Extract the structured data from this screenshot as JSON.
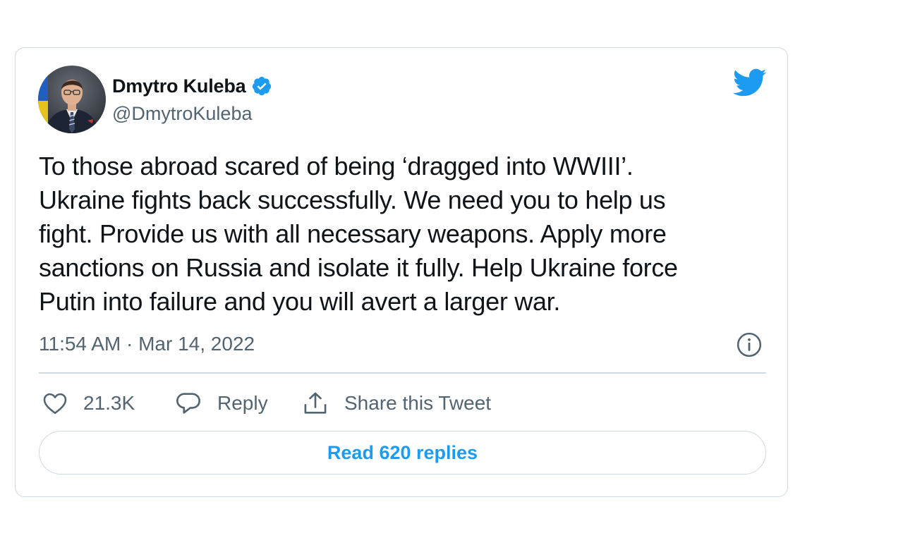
{
  "author": {
    "name": "Dmytro Kuleba",
    "handle": "@DmytroKuleba",
    "verified": true
  },
  "tweet": {
    "lines": [
      "To those abroad scared of being ‘dragged into WWIII’.",
      "Ukraine fights back successfully. We need you to help us",
      "fight. Provide us with all necessary weapons. Apply more",
      "sanctions on Russia and isolate it fully. Help Ukraine force",
      "Putin into failure and you will avert a larger war."
    ],
    "timestamp": "11:54 AM · Mar 14, 2022"
  },
  "actions": {
    "like_count": "21.3K",
    "reply_label": "Reply",
    "share_label": "Share this Tweet"
  },
  "read_replies_label": "Read 620 replies",
  "icons": {
    "brand": "twitter-bird-icon",
    "verified": "verified-badge-icon",
    "info": "info-icon",
    "like": "heart-icon",
    "reply": "speech-bubble-icon",
    "share": "share-upload-icon"
  },
  "colors": {
    "accent": "#1d9bf0",
    "text": "#0f1419",
    "secondary": "#536471",
    "border": "#cfd9de"
  }
}
